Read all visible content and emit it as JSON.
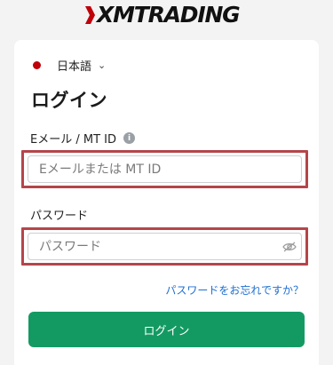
{
  "brand": {
    "logo_text": "XMTRADING",
    "accent_red": "#c0000a",
    "logo_icon": "xm-logo-icon"
  },
  "language": {
    "selected": "日本語",
    "flag_icon": "japan-flag-icon",
    "chevron_icon": "chevron-down-icon"
  },
  "login": {
    "title": "ログイン",
    "email_label": "Eメール / MT ID",
    "email_info_icon": "info-icon",
    "email_info_glyph": "i",
    "email_placeholder": "Eメールまたは MT ID",
    "email_value": "",
    "password_label": "パスワード",
    "password_placeholder": "パスワード",
    "password_value": "",
    "password_toggle_icon": "eye-slash-icon",
    "forgot_link": "パスワードをお忘れですか？",
    "submit_label": "ログイン",
    "highlight_color": "#b5454a",
    "button_color": "#139a62",
    "link_color": "#1d6fd1"
  }
}
